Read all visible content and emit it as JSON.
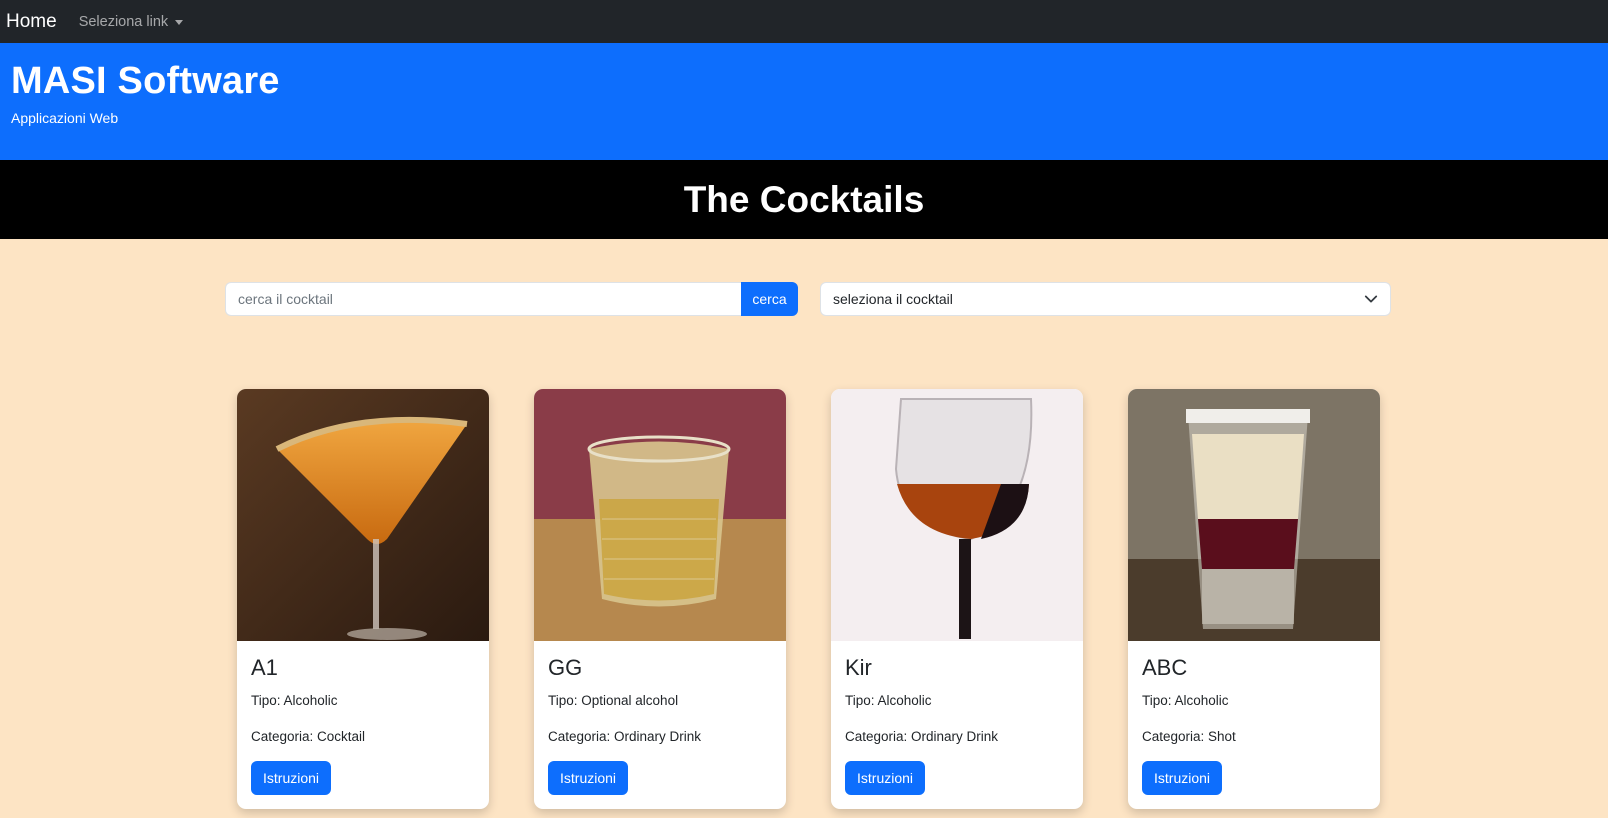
{
  "nav": {
    "brand": "Home",
    "dropdown_label": "Seleziona link"
  },
  "header": {
    "title": "MASI Software",
    "subtitle": "Applicazioni Web"
  },
  "page_title": "The Cocktails",
  "search": {
    "placeholder": "cerca il cocktail",
    "button_label": "cerca"
  },
  "select": {
    "selected": "seleziona il cocktail"
  },
  "cards": [
    {
      "name": "A1",
      "tipo": "Tipo: Alcoholic",
      "categoria": "Categoria: Cocktail",
      "button": "Istruzioni"
    },
    {
      "name": "GG",
      "tipo": "Tipo: Optional alcohol",
      "categoria": "Categoria: Ordinary Drink",
      "button": "Istruzioni"
    },
    {
      "name": "Kir",
      "tipo": "Tipo: Alcoholic",
      "categoria": "Categoria: Ordinary Drink",
      "button": "Istruzioni"
    },
    {
      "name": "ABC",
      "tipo": "Tipo: Alcoholic",
      "categoria": "Categoria: Shot",
      "button": "Istruzioni"
    }
  ],
  "colors": {
    "navbar": "#212529",
    "primary": "#0d6efd",
    "titlebar": "#000000",
    "page_bg": "#fde4c4"
  }
}
